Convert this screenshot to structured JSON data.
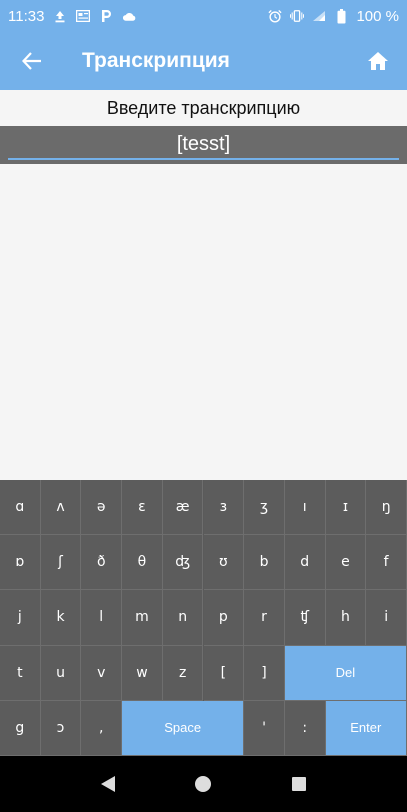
{
  "status_bar": {
    "time": "11:33",
    "battery": "100 %",
    "left_icons": [
      "upload-icon",
      "news-icon",
      "p-icon",
      "cloud-icon"
    ],
    "right_icons": [
      "alarm-icon",
      "vibrate-icon",
      "signal-icon",
      "battery-icon"
    ]
  },
  "app_bar": {
    "title": "Транскрипция",
    "back_icon": "arrow-left-icon",
    "home_icon": "home-icon"
  },
  "prompt": "Введите транскрипцию",
  "input": {
    "value": "[tesst]"
  },
  "keyboard": {
    "rows": [
      [
        "ɑ",
        "ʌ",
        "ə",
        "ɛ",
        "æ",
        "ɜ",
        "ʒ",
        "ı",
        "ɪ",
        "ŋ"
      ],
      [
        "ɒ",
        "ʃ",
        "ð",
        "θ",
        "ʤ",
        "ʊ",
        "b",
        "d",
        "e",
        "f"
      ],
      [
        "j",
        "k",
        "l",
        "m",
        "n",
        "p",
        "r",
        "ʧ",
        "h",
        "i"
      ],
      [
        "t",
        "u",
        "v",
        "w",
        "z",
        "[",
        "]",
        "Del"
      ],
      [
        "g",
        "ɔ",
        ",",
        "Space",
        "'",
        ":",
        "Enter"
      ]
    ],
    "del_label": "Del",
    "space_label": "Space",
    "enter_label": "Enter",
    "accent": "#74b1ea",
    "key_bg": "#5c5c5c"
  },
  "nav_bar": {
    "icons": [
      "back-triangle-icon",
      "home-circle-icon",
      "recents-square-icon"
    ]
  },
  "colors": {
    "primary": "#74b1ea",
    "background": "#f5f5f5",
    "input_bg": "#6b6b6b"
  }
}
